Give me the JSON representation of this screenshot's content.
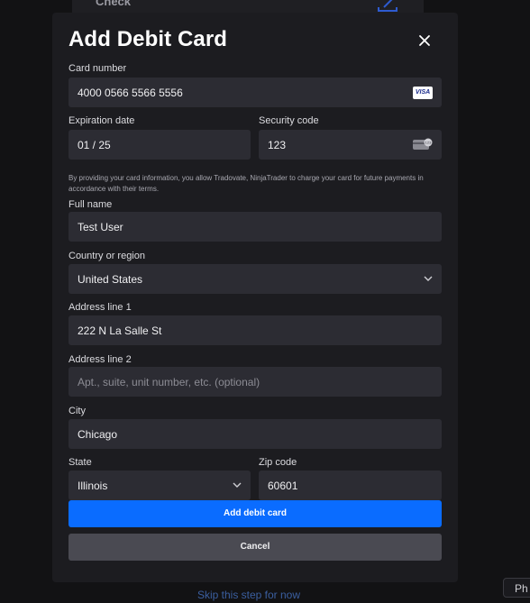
{
  "background": {
    "card_text": "Check",
    "skip_link": "Skip this step for now",
    "pill_text": "Ph"
  },
  "modal": {
    "title": "Add Debit Card",
    "close_icon": "close-icon"
  },
  "card_number": {
    "label": "Card number",
    "value": "4000 0566 5566 5556",
    "brand": "VISA"
  },
  "expiration": {
    "label": "Expiration date",
    "value": "01 / 25"
  },
  "security_code": {
    "label": "Security code",
    "value": "123",
    "icon": "cvc-card-icon"
  },
  "disclaimer": "By providing your card information, you allow Tradovate, NinjaTrader to charge your card for future payments in accordance with their terms.",
  "full_name": {
    "label": "Full name",
    "value": "Test User"
  },
  "country": {
    "label": "Country or region",
    "value": "United States"
  },
  "address1": {
    "label": "Address line 1",
    "value": "222 N La Salle St"
  },
  "address2": {
    "label": "Address line 2",
    "placeholder": "Apt., suite, unit number, etc. (optional)"
  },
  "city": {
    "label": "City",
    "value": "Chicago"
  },
  "state": {
    "label": "State",
    "value": "Illinois"
  },
  "zip": {
    "label": "Zip code",
    "value": "60601"
  },
  "buttons": {
    "submit": "Add debit card",
    "cancel": "Cancel"
  },
  "colors": {
    "primary": "#0a6cff",
    "modal_bg": "#1c1c20",
    "field_bg": "#2c2c33",
    "secondary_btn": "#4a4a52"
  }
}
